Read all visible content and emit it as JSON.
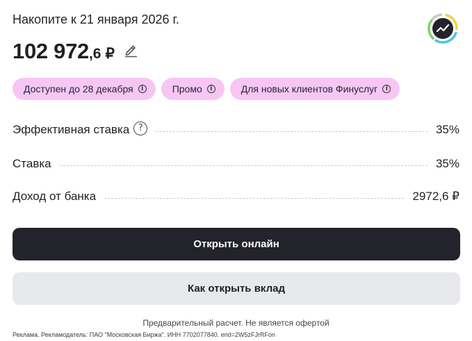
{
  "heading": "Накопите к 21 января 2026 г.",
  "amount": {
    "main": "102 972",
    "fraction": ",6",
    "currency": "₽"
  },
  "badges": [
    {
      "label": "Доступен до 28 декабря"
    },
    {
      "label": "Промо"
    },
    {
      "label": "Для новых клиентов Финуслуг"
    }
  ],
  "details": {
    "effective_rate": {
      "label": "Эффективная ставка",
      "value": "35%"
    },
    "rate": {
      "label": "Ставка",
      "value": "35%"
    },
    "income": {
      "label": "Доход от банка",
      "value": "2972,6 ₽"
    }
  },
  "buttons": {
    "open_online": "Открыть онлайн",
    "how_to_open": "Как открыть вклад"
  },
  "disclaimer": "Предварительный расчет. Не является офертой",
  "ad_note": "Реклама. Рекламодатель: ПАО \"Московская Биржа\". ИНН 7702077840.   erid=2W5zFJrRFon",
  "colors": {
    "badge_bg": "#f7c6f5",
    "primary_button": "#22232b",
    "secondary_button": "#e8e9ec"
  },
  "icons": {
    "logo": "chart-trend-icon",
    "edit": "pencil-icon",
    "info": "info-icon",
    "help": "question-icon"
  }
}
